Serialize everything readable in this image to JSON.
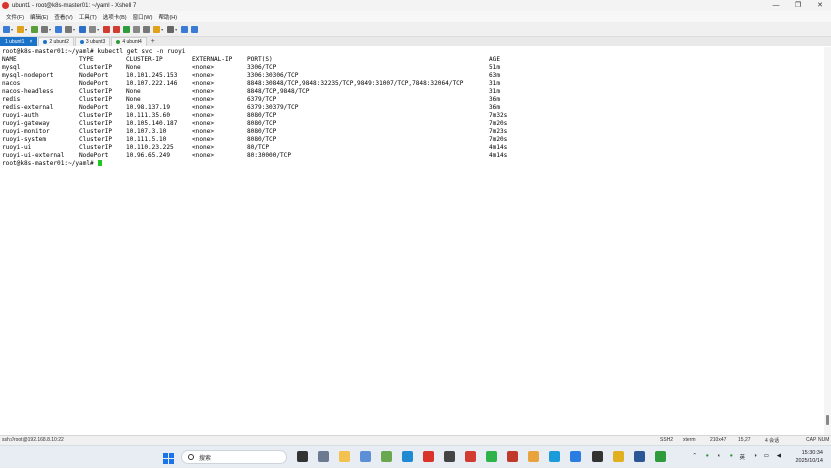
{
  "window": {
    "title": "ubunt1 - root@k8s-master01: ~/yaml - Xshell 7",
    "minimize": "—",
    "maximize": "❐",
    "close": "✕"
  },
  "menu": [
    "文件(F)",
    "编辑(E)",
    "查看(V)",
    "工具(T)",
    "选项卡(B)",
    "窗口(W)",
    "帮助(H)"
  ],
  "toolbar": {
    "icons": [
      "new-session-icon",
      "open-folder-icon",
      "reconnect-icon",
      "copy-icon",
      "find-icon",
      "settings-icon",
      "globe-icon",
      "script-icon",
      "record-icon",
      "xftp-icon",
      "fullscreen-icon",
      "lock-icon",
      "keyboard-icon",
      "compose-icon",
      "layout-icon",
      "help-icon",
      "chat-icon"
    ]
  },
  "tabs": [
    {
      "label": "1 ubunt1",
      "close": "×",
      "active": true,
      "dot": ""
    },
    {
      "label": "2 ubunt2",
      "close": "",
      "active": false,
      "dot": "#1b73c9"
    },
    {
      "label": "3 ubunt3",
      "close": "",
      "active": false,
      "dot": "#1b73c9"
    },
    {
      "label": "4 ubunt4",
      "close": "",
      "active": false,
      "dot": "#2e9b3d"
    }
  ],
  "tab_add": "+",
  "terminal": {
    "prompt_cmd": "root@k8s-master01:~/yaml# kubectl get svc -n ruoyi",
    "headers": [
      "NAME",
      "TYPE",
      "CLUSTER-IP",
      "EXTERNAL-IP",
      "PORT(S)",
      "AGE"
    ],
    "rows": [
      [
        "mysql",
        "ClusterIP",
        "None",
        "<none>",
        "3306/TCP",
        "51m"
      ],
      [
        "mysql-nodeport",
        "NodePort",
        "10.101.245.153",
        "<none>",
        "3306:30306/TCP",
        "63m"
      ],
      [
        "nacos",
        "NodePort",
        "10.107.222.146",
        "<none>",
        "8848:30848/TCP,9848:32235/TCP,9849:31007/TCP,7848:32064/TCP",
        "31m"
      ],
      [
        "nacos-headless",
        "ClusterIP",
        "None",
        "<none>",
        "8848/TCP,9848/TCP",
        "31m"
      ],
      [
        "redis",
        "ClusterIP",
        "None",
        "<none>",
        "6379/TCP",
        "36m"
      ],
      [
        "redis-external",
        "NodePort",
        "10.98.137.19",
        "<none>",
        "6379:30379/TCP",
        "36m"
      ],
      [
        "ruoyi-auth",
        "ClusterIP",
        "10.111.35.60",
        "<none>",
        "8080/TCP",
        "7m32s"
      ],
      [
        "ruoyi-gateway",
        "ClusterIP",
        "10.105.140.187",
        "<none>",
        "8080/TCP",
        "7m20s"
      ],
      [
        "ruoyi-monitor",
        "ClusterIP",
        "10.107.3.10",
        "<none>",
        "8080/TCP",
        "7m23s"
      ],
      [
        "ruoyi-system",
        "ClusterIP",
        "10.111.5.10",
        "<none>",
        "8080/TCP",
        "7m20s"
      ],
      [
        "ruoyi-ui",
        "ClusterIP",
        "10.110.23.225",
        "<none>",
        "80/TCP",
        "4m14s"
      ],
      [
        "ruoyi-ui-external",
        "NodePort",
        "10.96.65.249",
        "<none>",
        "80:30000/TCP",
        "4m14s"
      ]
    ],
    "final_prompt": "root@k8s-master01:~/yaml# ",
    "cursor_color": "#1ec81e"
  },
  "status": {
    "connection": "ssh://root@192.168.8.10:22",
    "protocol": "SSH2",
    "term": "xterm",
    "size": "210x47",
    "cursor_pos": "15,27",
    "sessions": "4 会话",
    "cap": "CAP",
    "num": "NUM"
  },
  "taskbar": {
    "search_placeholder": "搜索",
    "tray_ime": "英",
    "time": "15:30:34",
    "date": "2025/10/14"
  }
}
